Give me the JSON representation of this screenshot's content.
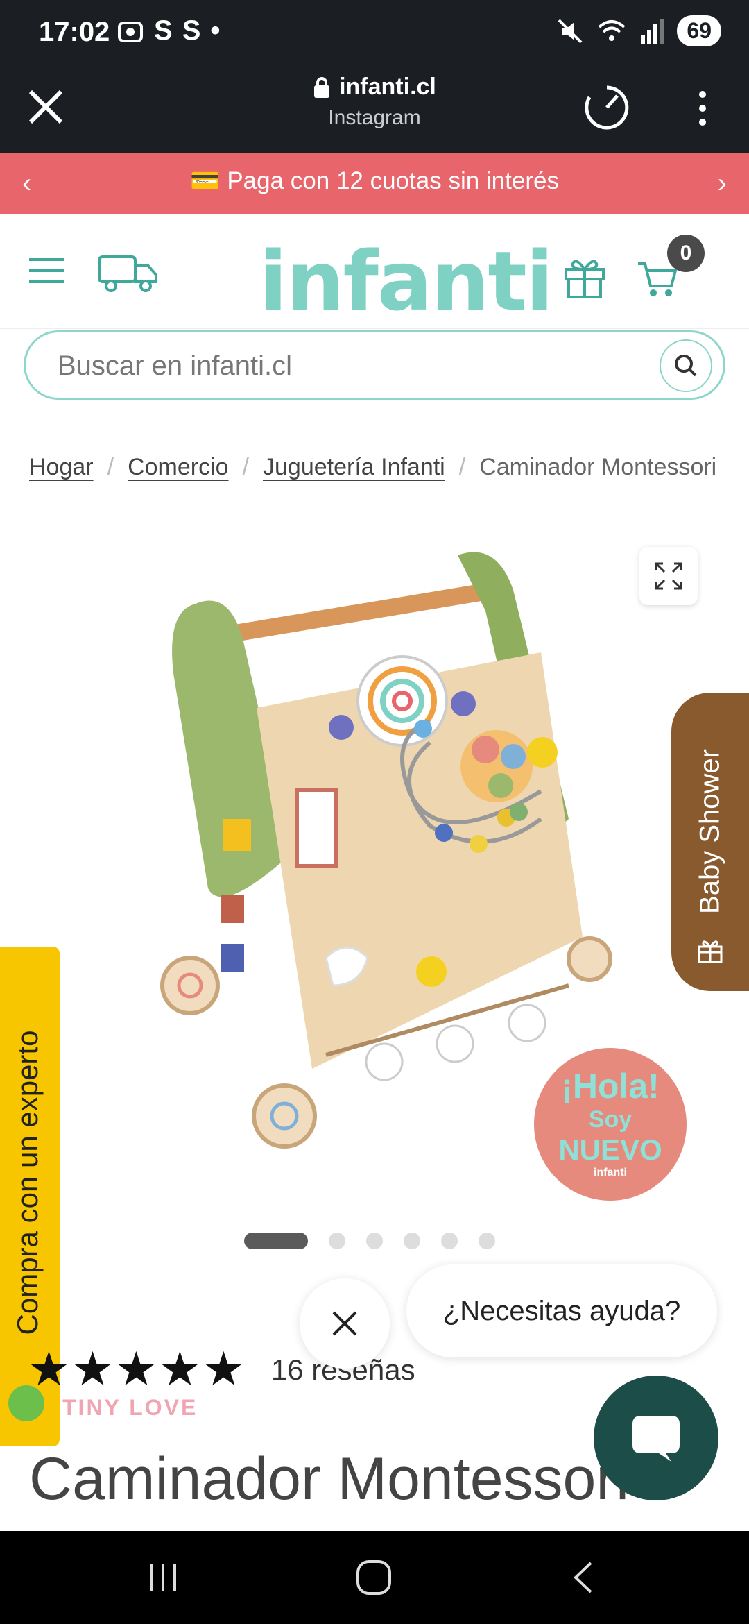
{
  "status_bar": {
    "time": "17:02",
    "left_icons": [
      "screenshot-icon",
      "S",
      "S",
      "•"
    ],
    "battery": "69"
  },
  "browser": {
    "domain": "infanti.cl",
    "source": "Instagram"
  },
  "promo": {
    "text": "💳 Paga con 12 cuotas sin interés",
    "prev": "‹",
    "next": "›"
  },
  "header": {
    "logo": "infanti",
    "cart_count": "0"
  },
  "search": {
    "placeholder": "Buscar en infanti.cl"
  },
  "breadcrumb": {
    "items": [
      "Hogar",
      "Comercio",
      "Juguetería Infanti"
    ],
    "current": "Caminador Montessori"
  },
  "side_tabs": {
    "baby_shower": "Baby Shower",
    "expert": "Compra con un experto"
  },
  "badge": {
    "line1": "¡Hola!",
    "line2": "Soy",
    "line3": "NUEVO",
    "brand": "infanti"
  },
  "rating": {
    "stars": "★★★★★",
    "count": "16 reseñas",
    "value": 5
  },
  "product": {
    "brand": "TINY LOVE",
    "title": "Caminador Montessori"
  },
  "chat": {
    "prompt": "¿Necesitas ayuda?"
  },
  "colors": {
    "promo": "#e8656c",
    "brand_teal": "#7fd1c4",
    "baby_tab": "#8a5a2f",
    "expert_tab": "#f7c600",
    "chat_fab": "#1d4d48"
  }
}
